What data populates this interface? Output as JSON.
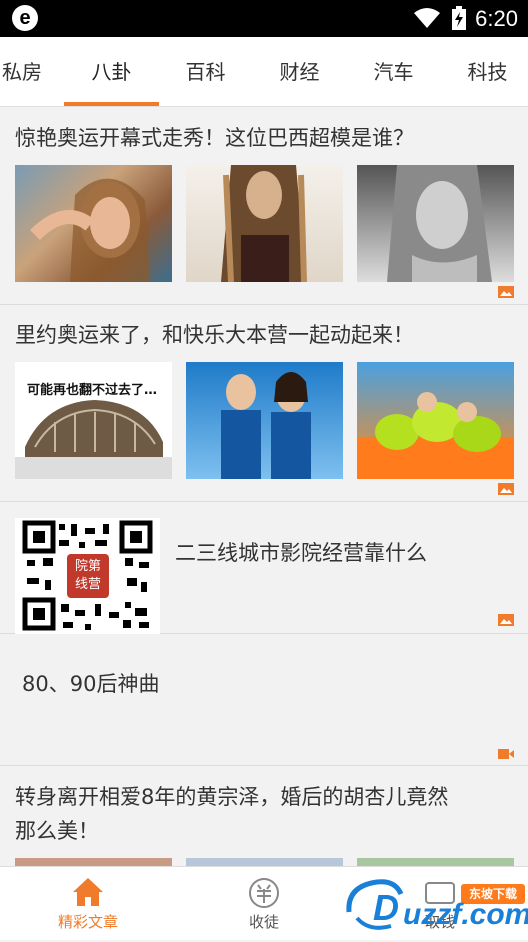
{
  "statusbar": {
    "app_letter": "e",
    "time": "6:20"
  },
  "tabs": [
    {
      "label": "私房"
    },
    {
      "label": "八卦"
    },
    {
      "label": "百科"
    },
    {
      "label": "财经"
    },
    {
      "label": "汽车"
    },
    {
      "label": "科技"
    }
  ],
  "active_tab_index": 1,
  "accent_color": "#f07b2a",
  "articles": [
    {
      "title": "惊艳奥运开幕式走秀！这位巴西超模是谁？",
      "media": "image"
    },
    {
      "title": "里约奥运来了，和快乐大本营一起动起来！",
      "media": "image",
      "thumb_caption": "可能再也翻不过去了…"
    },
    {
      "title": "二三线城市影院经营靠什么",
      "media": "image",
      "qr_stamp": "院第线营"
    },
    {
      "title": "80、90后神曲",
      "media": "video"
    },
    {
      "title_line1": "转身离开相爱8年的黄宗泽，婚后的胡杏儿竟然",
      "title_line2": "那么美！",
      "media": "image"
    }
  ],
  "bottom_nav": [
    {
      "label": "精彩文章",
      "icon": "home-icon",
      "active": true
    },
    {
      "label": "收徒",
      "icon": "yang-coin-icon",
      "active": false
    },
    {
      "label": "取钱",
      "icon": "wallet-icon",
      "active": false
    }
  ],
  "watermark": {
    "text": "uzzf.com",
    "badge": "东坡下载"
  }
}
